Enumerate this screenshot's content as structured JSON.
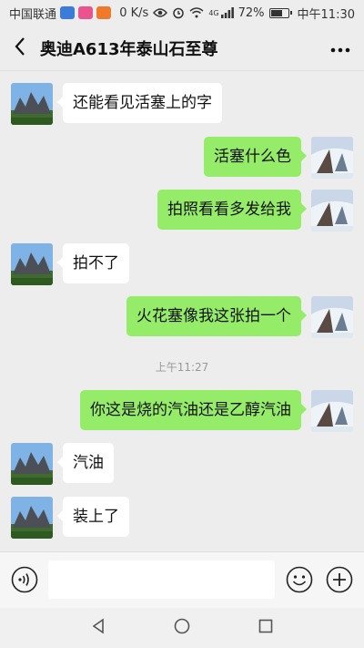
{
  "status_bar": {
    "carrier": "中国联通",
    "speed": "0 K/s",
    "network": "4G",
    "battery_percent": "72%",
    "battery_level": 0.72,
    "time": "中午11:30"
  },
  "header": {
    "title": "奥迪A613年泰山石至尊",
    "back_icon": "chevron-left-icon",
    "more_icon": "more-dots-icon"
  },
  "messages": [
    {
      "side": "in",
      "text": "还能看见活塞上的字"
    },
    {
      "side": "out",
      "text": "活塞什么色"
    },
    {
      "side": "out",
      "text": "拍照看看多发给我"
    },
    {
      "side": "in",
      "text": "拍不了"
    },
    {
      "side": "out",
      "text": "火花塞像我这张拍一个"
    },
    {
      "side": "out",
      "text": "你这是烧的汽油还是乙醇汽油"
    },
    {
      "side": "in",
      "text": "汽油"
    },
    {
      "side": "in",
      "text": "装上了"
    }
  ],
  "time_separator": "上午11:27",
  "input_bar": {
    "value": "",
    "voice_icon": "voice-icon",
    "emoji_icon": "emoji-icon",
    "plus_icon": "plus-icon"
  },
  "colors": {
    "background": "#ededed",
    "outgoing_bubble": "#95ec69",
    "incoming_bubble": "#ffffff"
  }
}
